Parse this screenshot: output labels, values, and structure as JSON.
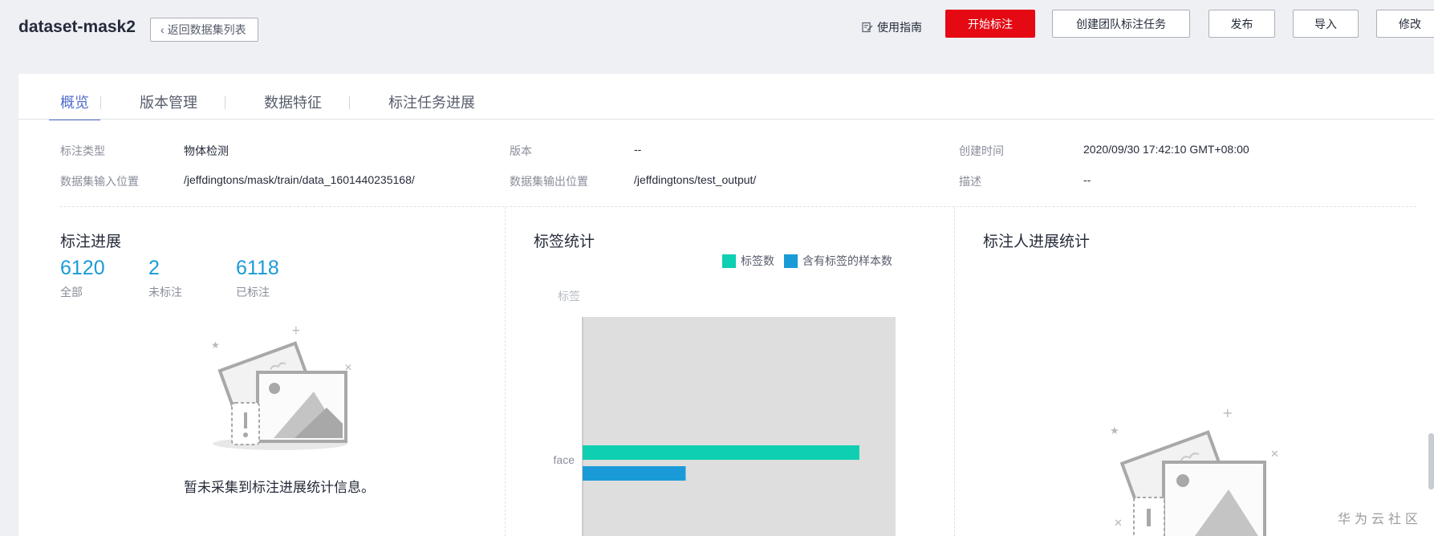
{
  "header": {
    "title": "dataset-mask2",
    "back_label": "返回数据集列表",
    "guide_label": "使用指南",
    "buttons": {
      "start_label": "开始标注",
      "team_label": "创建团队标注任务",
      "publish_label": "发布",
      "import_label": "导入",
      "edit_label": "修改"
    },
    "accent_color": "#e50914"
  },
  "tabs": [
    {
      "label": "概览",
      "active": true
    },
    {
      "label": "版本管理",
      "active": false
    },
    {
      "label": "数据特征",
      "active": false
    },
    {
      "label": "标注任务进展",
      "active": false
    }
  ],
  "info": {
    "label_type_key": "标注类型",
    "label_type_val": "物体检测",
    "version_key": "版本",
    "version_val": "--",
    "created_key": "创建时间",
    "created_val": "2020/09/30 17:42:10 GMT+08:00",
    "input_key": "数据集输入位置",
    "input_val": "/jeffdingtons/mask/train/data_1601440235168/",
    "output_key": "数据集输出位置",
    "output_val": "/jeffdingtons/test_output/",
    "desc_key": "描述",
    "desc_val": "--"
  },
  "progress": {
    "title": "标注进展",
    "total": "6120",
    "total_label": "全部",
    "unlabeled": "2",
    "unlabeled_label": "未标注",
    "labeled": "6118",
    "labeled_label": "已标注",
    "empty_message": "暂未采集到标注进展统计信息。"
  },
  "label_stats": {
    "title": "标签统计",
    "legend": [
      "标签数",
      "含有标签的样本数"
    ],
    "colors": [
      "#0fcfb2",
      "#1a9bd7"
    ],
    "axis_title": "标签"
  },
  "annotator_stats": {
    "title": "标注人进展统计"
  },
  "chart_data": {
    "type": "bar",
    "orientation": "horizontal",
    "categories": [
      "face"
    ],
    "series": [
      {
        "name": "标签数",
        "values": [
          10260
        ]
      },
      {
        "name": "含有标签的样本数",
        "values": [
          3820
        ]
      }
    ],
    "xlim": [
      0,
      11600
    ],
    "ylabel": "标签"
  },
  "watermark": "华为云社区"
}
